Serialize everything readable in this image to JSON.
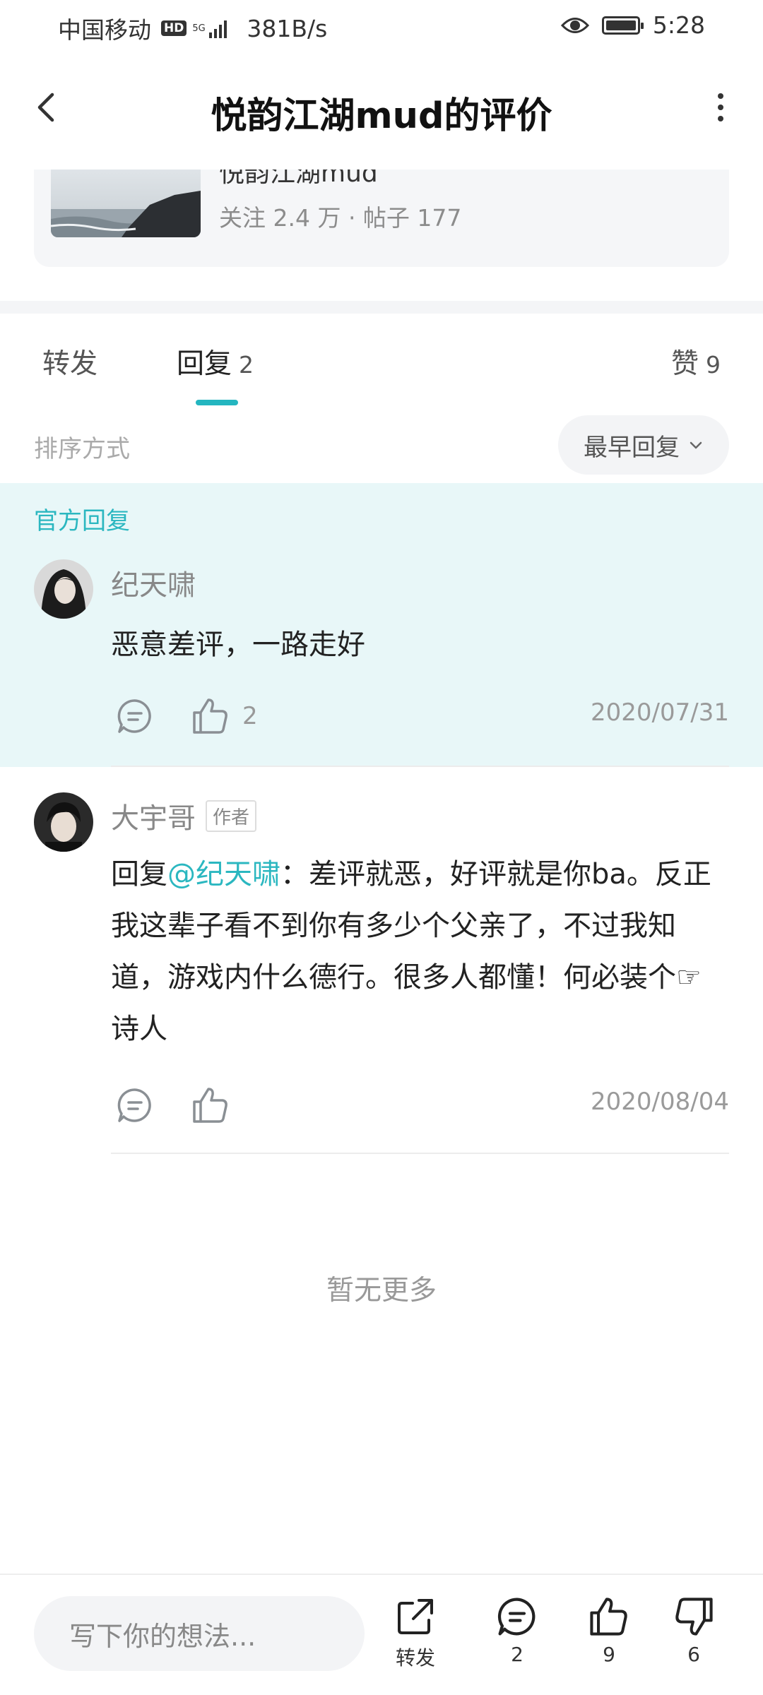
{
  "status_bar": {
    "carrier": "中国移动",
    "hd": "HD",
    "network_type": "5G",
    "speed": "381B/s",
    "time": "5:28"
  },
  "header": {
    "title": "悦韵江湖mud的评价"
  },
  "game_card": {
    "name": "悦韵江湖mud",
    "stats": "关注 2.4 万 · 帖子 177"
  },
  "tabs": [
    {
      "label": "转发",
      "count": ""
    },
    {
      "label": "回复",
      "count": "2"
    },
    {
      "label": "赞",
      "count": "9"
    }
  ],
  "sort": {
    "label": "排序方式",
    "selected": "最早回复"
  },
  "official": {
    "label": "官方回复"
  },
  "comments": [
    {
      "author": "纪天啸",
      "tag": "",
      "text": "恶意差评，一路走好",
      "likes": "2",
      "date": "2020/07/31"
    },
    {
      "author": "大宇哥",
      "tag": "作者",
      "reply_prefix": "回复",
      "mention": "@纪天啸",
      "text": "：差评就恶，好评就是你ba。反正我这辈子看不到你有多少个父亲了，不过我知道，游戏内什么德行。很多人都懂！何必装个☞诗人",
      "likes": "",
      "date": "2020/08/04"
    }
  ],
  "footer_note": "暂无更多",
  "bottom_bar": {
    "input_placeholder": "写下你的想法...",
    "share_label": "转发",
    "comment_count": "2",
    "like_count": "9",
    "dislike_count": "6"
  },
  "colors": {
    "accent": "#24b6c0",
    "official_bg": "#e8f7f8"
  }
}
